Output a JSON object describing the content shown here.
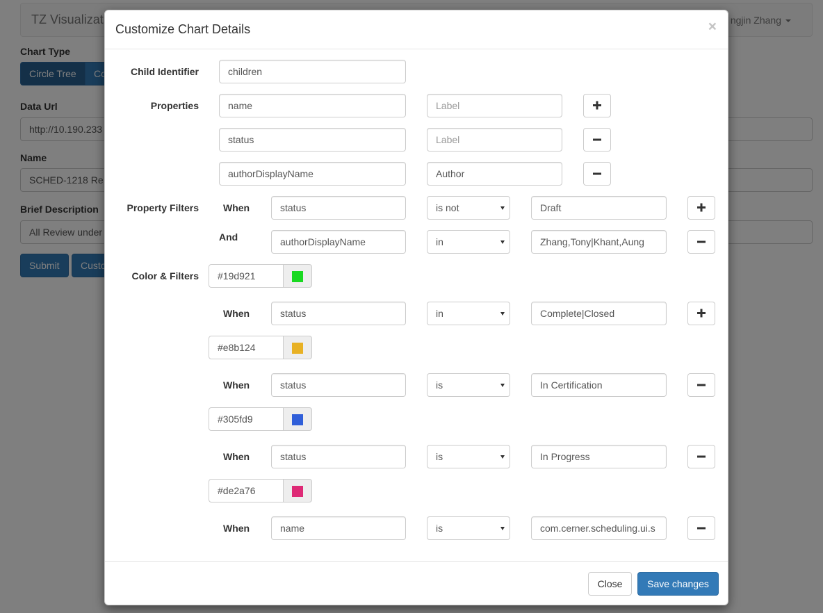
{
  "background": {
    "brand": "TZ Visualizat",
    "user": "ngjin Zhang",
    "chart_type_label": "Chart Type",
    "chart_type_buttons": [
      "Circle Tree",
      "Co"
    ],
    "data_url_label": "Data Url",
    "data_url_value": "http://10.190.233",
    "name_label": "Name",
    "name_value": "SCHED-1218 Re",
    "brief_label": "Brief Description",
    "brief_value": "All Review under",
    "submit": "Submit",
    "custo": "Custo"
  },
  "modal": {
    "title": "Customize Chart Details",
    "close_glyph": "×",
    "child_identifier": {
      "label": "Child Identifier",
      "value": "children"
    },
    "properties": {
      "label": "Properties",
      "rows": [
        {
          "name": "name",
          "label_value": "",
          "label_placeholder": "Label",
          "action": "+"
        },
        {
          "name": "status",
          "label_value": "",
          "label_placeholder": "Label",
          "action": "−"
        },
        {
          "name": "authorDisplayName",
          "label_value": "Author",
          "label_placeholder": "Label",
          "action": "−"
        }
      ]
    },
    "property_filters": {
      "label": "Property Filters",
      "rows": [
        {
          "conj": "When",
          "field": "status",
          "op": "is not",
          "value": "Draft",
          "action": "+"
        },
        {
          "conj": "And",
          "field": "authorDisplayName",
          "op": "in",
          "value": "Zhang,Tony|Khant,Aung",
          "action": "−"
        }
      ]
    },
    "color_filters": {
      "label": "Color & Filters",
      "groups": [
        {
          "color": "#19d921",
          "conj": "When",
          "field": "status",
          "op": "in",
          "value": "Complete|Closed",
          "action": "+"
        },
        {
          "color": "#e8b124",
          "conj": "When",
          "field": "status",
          "op": "is",
          "value": "In Certification",
          "action": "−"
        },
        {
          "color": "#305fd9",
          "conj": "When",
          "field": "status",
          "op": "is",
          "value": "In Progress",
          "action": "−"
        },
        {
          "color": "#de2a76",
          "conj": "When",
          "field": "name",
          "op": "is",
          "value": "com.cerner.scheduling.ui.s",
          "action": "−"
        }
      ]
    },
    "footer": {
      "close": "Close",
      "save": "Save changes"
    }
  },
  "colors": {
    "primary": "#337ab7",
    "backdrop": "rgba(0,0,0,0.5)"
  }
}
